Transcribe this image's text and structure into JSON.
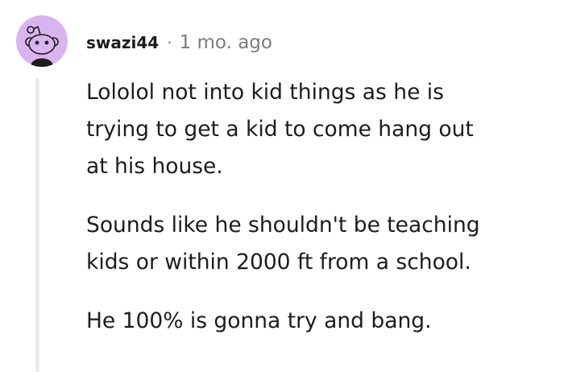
{
  "comment": {
    "username": "swazi44",
    "separator": "·",
    "timestamp": "1 mo. ago",
    "paragraphs": [
      {
        "lines": [
          "Lololol not into kid things as he is",
          "trying to get a kid to come hang out",
          "at his house."
        ]
      },
      {
        "lines": [
          "Sounds like he shouldn't be teaching",
          "kids or within 2000 ft from a school."
        ]
      },
      {
        "lines": [
          "He 100% is gonna try and bang."
        ]
      }
    ]
  },
  "avatar": {
    "icon": "snoo-avatar-icon",
    "background": "#d8b4f0",
    "body_color": "#1c1c1c"
  }
}
